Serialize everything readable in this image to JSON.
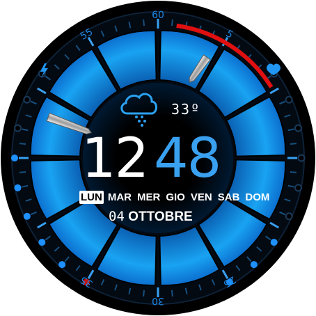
{
  "time": {
    "hour": "12",
    "minute": "48"
  },
  "weather": {
    "temperature": "33º",
    "icon": "cloud-rain-icon"
  },
  "weekdays": [
    {
      "label": "LUN",
      "active": true
    },
    {
      "label": "MAR",
      "active": false
    },
    {
      "label": "MER",
      "active": false
    },
    {
      "label": "GIO",
      "active": false
    },
    {
      "label": "VEN",
      "active": false
    },
    {
      "label": "SAB",
      "active": false
    },
    {
      "label": "DOM",
      "active": false
    }
  ],
  "date": {
    "day": "04",
    "month": "OTTOBRE"
  },
  "dial_numbers": [
    {
      "label": "60",
      "value": 60
    },
    {
      "label": "5",
      "value": 5
    },
    {
      "label": "25",
      "value": 25
    },
    {
      "label": "30",
      "value": 30
    },
    {
      "label": "35",
      "value": 35
    },
    {
      "label": "55",
      "value": 55
    }
  ],
  "icons": {
    "left": "lightning-icon",
    "right": "heart-icon"
  },
  "colors": {
    "accent": "#1ea8f5",
    "accent_dark": "#0a4fa0",
    "alert": "#e01010",
    "background": "#000000"
  }
}
